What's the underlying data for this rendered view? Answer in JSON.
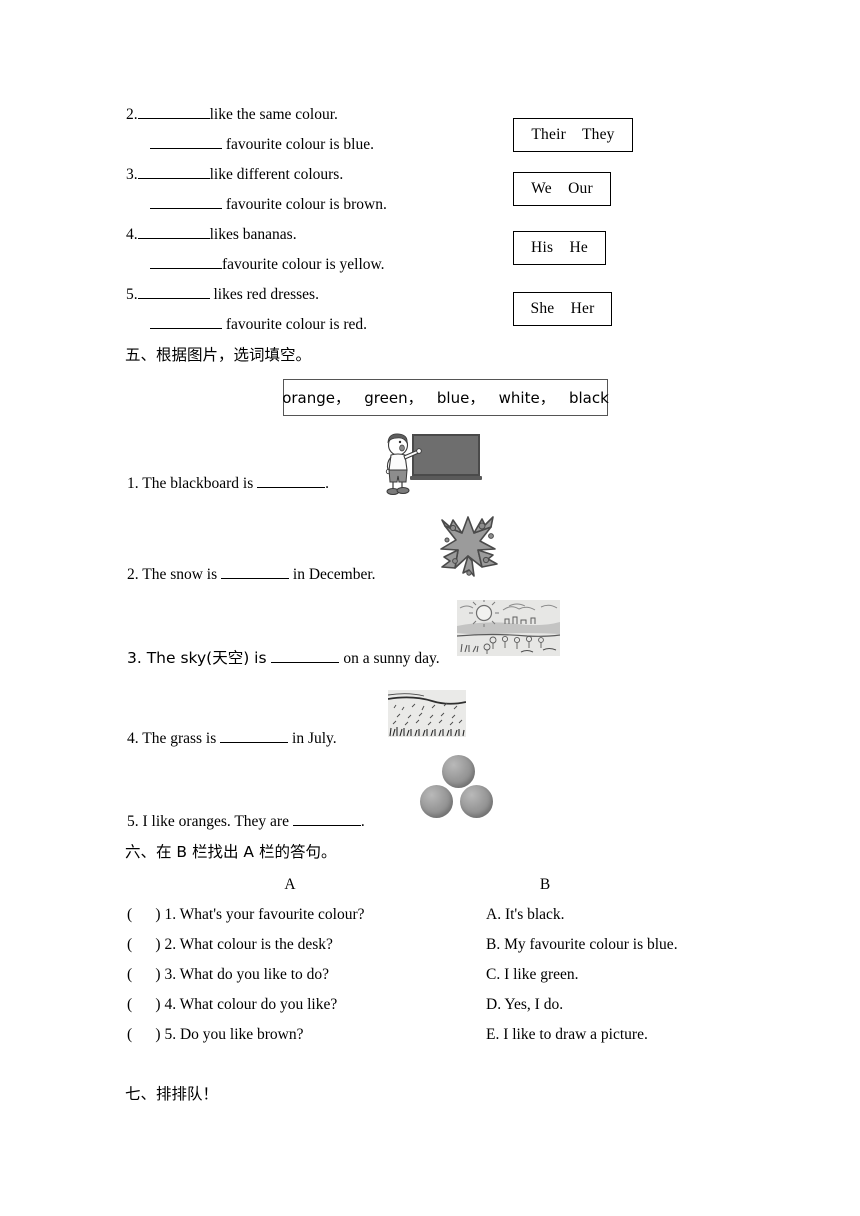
{
  "exercise_four": {
    "items": [
      {
        "number": "2.",
        "line1_text": "like the same colour.",
        "line2_text": " favourite colour is blue."
      },
      {
        "number": "3.",
        "line1_text": "like different colours.",
        "line2_text": " favourite colour is brown."
      },
      {
        "number": "4.",
        "line1_text": "likes bananas.",
        "line2_text": "favourite colour is yellow."
      },
      {
        "number": "5.",
        "line1_text": " likes red dresses.",
        "line2_text": " favourite colour is red."
      }
    ],
    "option_boxes": [
      {
        "text": "Their    They"
      },
      {
        "text": "We    Our"
      },
      {
        "text": "His    He"
      },
      {
        "text": "She    Her"
      }
    ]
  },
  "exercise_five": {
    "heading": "五、根据图片，选词填空。",
    "word_bank": "orange，   green，   blue，   white，   black",
    "questions": [
      {
        "prefix": "1. The blackboard is ",
        "suffix": ".",
        "image": "blackboard-illustration"
      },
      {
        "prefix": "2. The snow is ",
        "suffix": " in December.",
        "image": "snowflake-illustration"
      },
      {
        "prefix": "3. The sky(天空) is ",
        "suffix": " on a sunny day.",
        "image": "sunny-landscape-illustration"
      },
      {
        "prefix": "4. The grass is ",
        "suffix": " in July.",
        "image": "grass-illustration"
      },
      {
        "prefix": "5. I like oranges. They are ",
        "suffix": ".",
        "image": "oranges-illustration"
      }
    ]
  },
  "exercise_six": {
    "heading": "六、在 B 栏找出 A 栏的答句。",
    "column_a_header": "A",
    "column_b_header": "B",
    "column_a": [
      "(      ) 1. What's your favourite colour?",
      "(      ) 2. What colour is the desk?",
      "(      ) 3. What do you like to do?",
      "(      ) 4. What colour do you like?",
      "(      ) 5. Do you like brown?"
    ],
    "column_b": [
      "A. It's black.",
      "B. My favourite colour is blue.",
      "C. I like green.",
      "D. Yes, I do.",
      "E. I like to draw a picture."
    ]
  },
  "exercise_seven": {
    "heading": "七、排排队！"
  }
}
